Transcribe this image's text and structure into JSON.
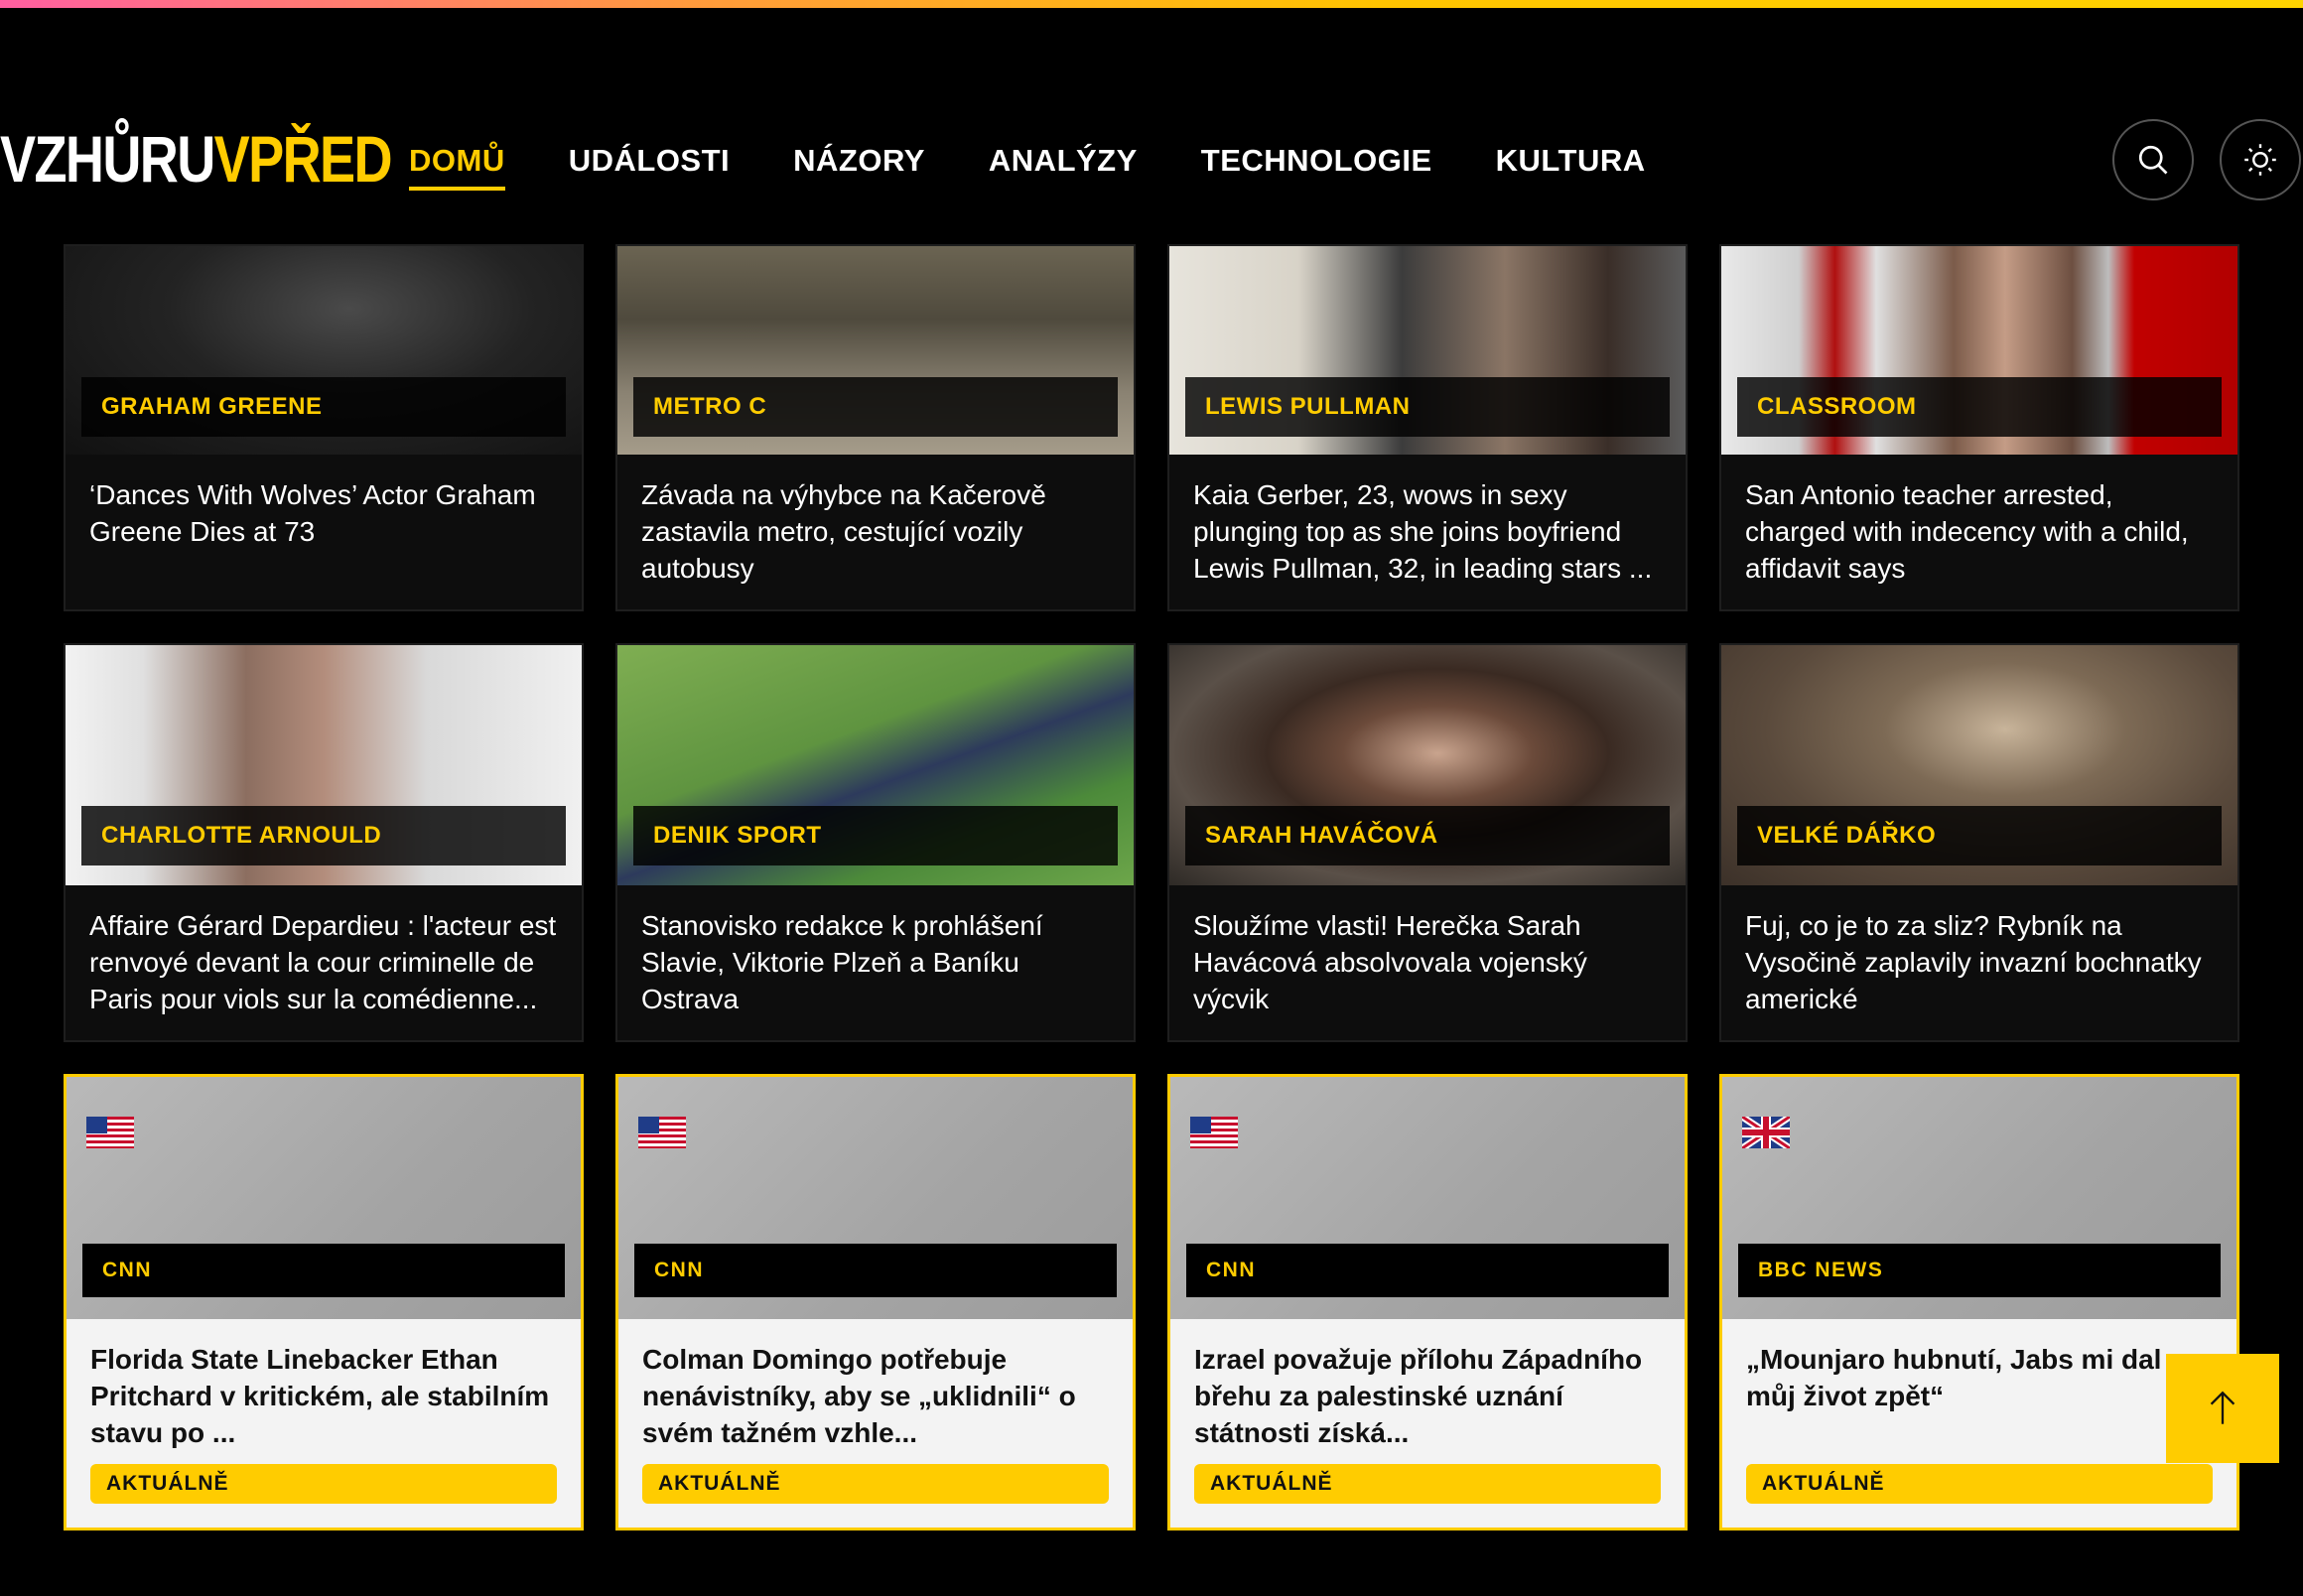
{
  "site": {
    "logo_white": "VZHŮRU",
    "logo_yellow": "VPŘED"
  },
  "nav": {
    "items": [
      "DOMŮ",
      "UDÁLOSTI",
      "NÁZORY",
      "ANALÝZY",
      "TECHNOLOGIE",
      "KULTURA"
    ],
    "active": "DOMŮ"
  },
  "header_actions": {
    "search_icon": "search-icon",
    "theme_icon": "sun-icon"
  },
  "articles_row1": [
    {
      "tag": "GRAHAM GREENE",
      "title": "‘Dances With Wolves’ Actor Graham Greene Dies at 73"
    },
    {
      "tag": "METRO C",
      "title": "Závada na výhybce na Kačerově zastavila metro, cestující vozily autobusy"
    },
    {
      "tag": "LEWIS PULLMAN",
      "title": "Kaia Gerber, 23, wows in sexy plunging top as she joins boyfriend Lewis Pullman, 32, in leading stars ..."
    },
    {
      "tag": "CLASSROOM",
      "title": "San Antonio teacher arrested, charged with indecency with a child, affidavit says"
    }
  ],
  "articles_row2": [
    {
      "tag": "CHARLOTTE ARNOULD",
      "title": "Affaire Gérard Depardieu : l'acteur est renvoyé devant la cour criminelle de Paris pour viols sur la comédienne..."
    },
    {
      "tag": "DENIK SPORT",
      "title": "Stanovisko redakce k prohlášení Slavie, Viktorie Plzeň a Baníku Ostrava"
    },
    {
      "tag": "SARAH HAVÁČOVÁ",
      "title": "Sloužíme vlasti! Herečka Sarah Havácová absolvovala vojenský výcvik"
    },
    {
      "tag": "VELKÉ DÁŘKO",
      "title": "Fuj, co je to za sliz? Rybník na Vysočině zaplavily invazní bochnatky americké"
    }
  ],
  "articles_row3": [
    {
      "flag": "us-flag-icon",
      "tag": "CNN",
      "title": "Florida State Linebacker Ethan Pritchard v kritickém, ale stabilním stavu po ...",
      "badge": "AKTUÁLNĚ"
    },
    {
      "flag": "us-flag-icon",
      "tag": "CNN",
      "title": "Colman Domingo potřebuje nenávistníky, aby se „uklidnili“ o svém tažném vzhle...",
      "badge": "AKTUÁLNĚ"
    },
    {
      "flag": "us-flag-icon",
      "tag": "CNN",
      "title": "Izrael považuje přílohu Západního břehu za palestinské uznání státnosti získá...",
      "badge": "AKTUÁLNĚ"
    },
    {
      "flag": "uk-flag-icon",
      "tag": "BBC NEWS",
      "title": "„Mounjaro hubnutí, Jabs mi dal můj život zpět“",
      "badge": "AKTUÁLNĚ"
    }
  ],
  "colors": {
    "accent": "#ffcc00",
    "background": "#000000",
    "card": "#0d0d0d"
  }
}
